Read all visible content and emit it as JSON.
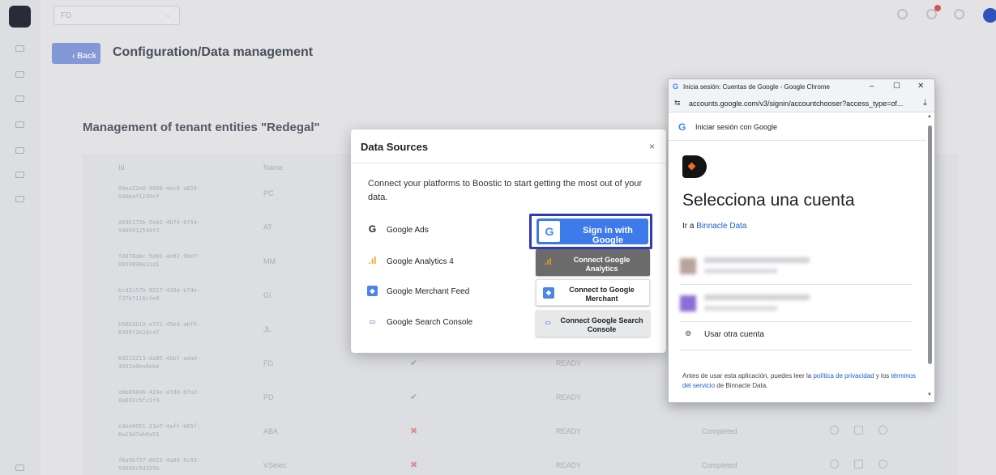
{
  "app": {
    "tenant_select_value": "FD",
    "back_label": "‹ Back",
    "page_title": "Configuration/Data management",
    "section_title": "Management of tenant entities \"Redegal\"",
    "table_headers": [
      "Id",
      "Name"
    ],
    "rows": [
      {
        "id": "09ea22e0-5806-4ec8-a828-03bbaf1199cf",
        "name": "PC",
        "mark": "",
        "status": "",
        "completed": ""
      },
      {
        "id": "d43b172b-5eb2-4b74-8f54-9460912540f2",
        "name": "AT",
        "mark": "",
        "status": "",
        "completed": ""
      },
      {
        "id": "f0878d4c-5d01-4e82-90e7-0659890e11d1",
        "name": "MM",
        "mark": "",
        "status": "",
        "completed": ""
      },
      {
        "id": "bcd2c57b-8217-420d-b74e-f37b7116cfe0",
        "name": "GI",
        "mark": "",
        "status": "",
        "completed": ""
      },
      {
        "id": "b50b2b19-e721-45ed-abf5-6499f2e2dca7",
        "name": "JL",
        "mark": "",
        "status": "",
        "completed": ""
      },
      {
        "id": "64212213-da85-4bbf-ada0-4452a0ea6ebe",
        "name": "FD",
        "mark": "✔",
        "status": "READY",
        "completed": ""
      },
      {
        "id": "a6b09846-424e-47dd-b7a2-8a633c5fc1f4",
        "name": "PD",
        "mark": "✔",
        "status": "READY",
        "completed": ""
      },
      {
        "id": "e3ed4951-21e7-4aff-b65f-8a13d7ab6a51",
        "name": "ABA",
        "mark": "✖",
        "status": "READY",
        "completed": "Completed"
      },
      {
        "id": "f6a9bf57-0015-4a89-9c93-54699c54329b",
        "name": "VSelec",
        "mark": "✖",
        "status": "READY",
        "completed": "Completed"
      }
    ]
  },
  "modal": {
    "title": "Data Sources",
    "close": "×",
    "description": "Connect your platforms to Boostic to start getting the most out of your data.",
    "sources": [
      {
        "icon": "G",
        "icon_color": "#222222",
        "label": "Google Ads"
      },
      {
        "icon": ".ıl",
        "icon_color": "#f4a21d",
        "label": "Google Analytics 4",
        "button": "Connect Google Analytics",
        "button_icon": ".ıl"
      },
      {
        "icon": "◆",
        "icon_color": "#4a86e8",
        "label": "Google Merchant Feed",
        "button": "Connect to Google Merchant",
        "button_icon": "◆"
      },
      {
        "icon": "▭",
        "icon_color": "#7aa0d8",
        "label": "Google Search Console",
        "button": "Connect Google Search Console",
        "button_icon": "▭"
      }
    ],
    "sign_in_button": "Sign in with Google",
    "sign_in_icon": "G"
  },
  "popup": {
    "window_title": "Inicia sesión: Cuentas de Google - Google Chrome",
    "window_controls": [
      "–",
      "☐",
      "✕"
    ],
    "url": "accounts.google.com/v3/signin/accountchooser?access_type=of...",
    "header": "Iniciar sesión con Google",
    "heading": "Selecciona una cuenta",
    "sub_prefix": "Ir a ",
    "sub_link": "Binnacle Data",
    "other_account": "Usar otra cuenta",
    "footer_1": "Antes de usar esta aplicación, puedes leer la ",
    "footer_link_1": "política de privacidad",
    "footer_2": " y los ",
    "footer_link_2": "términos del servicio",
    "footer_3": " de Binnacle Data."
  },
  "colors": {
    "primary_button": "#3e7bea",
    "focus_ring": "#2f3bb5",
    "dark_button": "#6b6b6b",
    "link": "#1a5fd0",
    "brand_orange": "#f26b21"
  }
}
